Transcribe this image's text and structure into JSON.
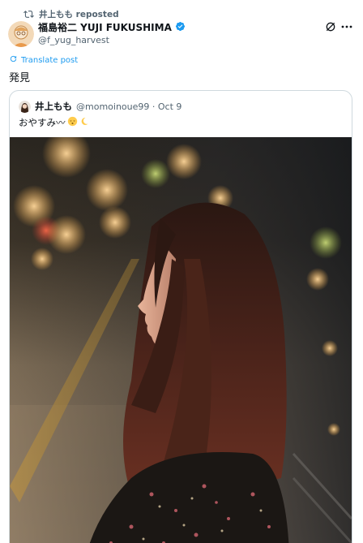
{
  "repost": {
    "icon": "repost-icon",
    "text": "井上もも reposted"
  },
  "post": {
    "author_name": "福島裕二 YUJI FUKUSHIMA",
    "author_handle": "@f_yug_harvest",
    "verified": true,
    "translate_label": "Translate post",
    "text": "発見"
  },
  "quote": {
    "author_name": "井上もも",
    "handle_and_date": "@momoinoue99 · Oct 9",
    "text": "おやすみ〰",
    "emojis": [
      "sleeping-face-icon",
      "crescent-moon-icon"
    ],
    "photo_alt": "photo"
  },
  "colors": {
    "text": "#0f1419",
    "secondary": "#536471",
    "accent": "#1d9bf0",
    "border": "#cfd9de"
  }
}
